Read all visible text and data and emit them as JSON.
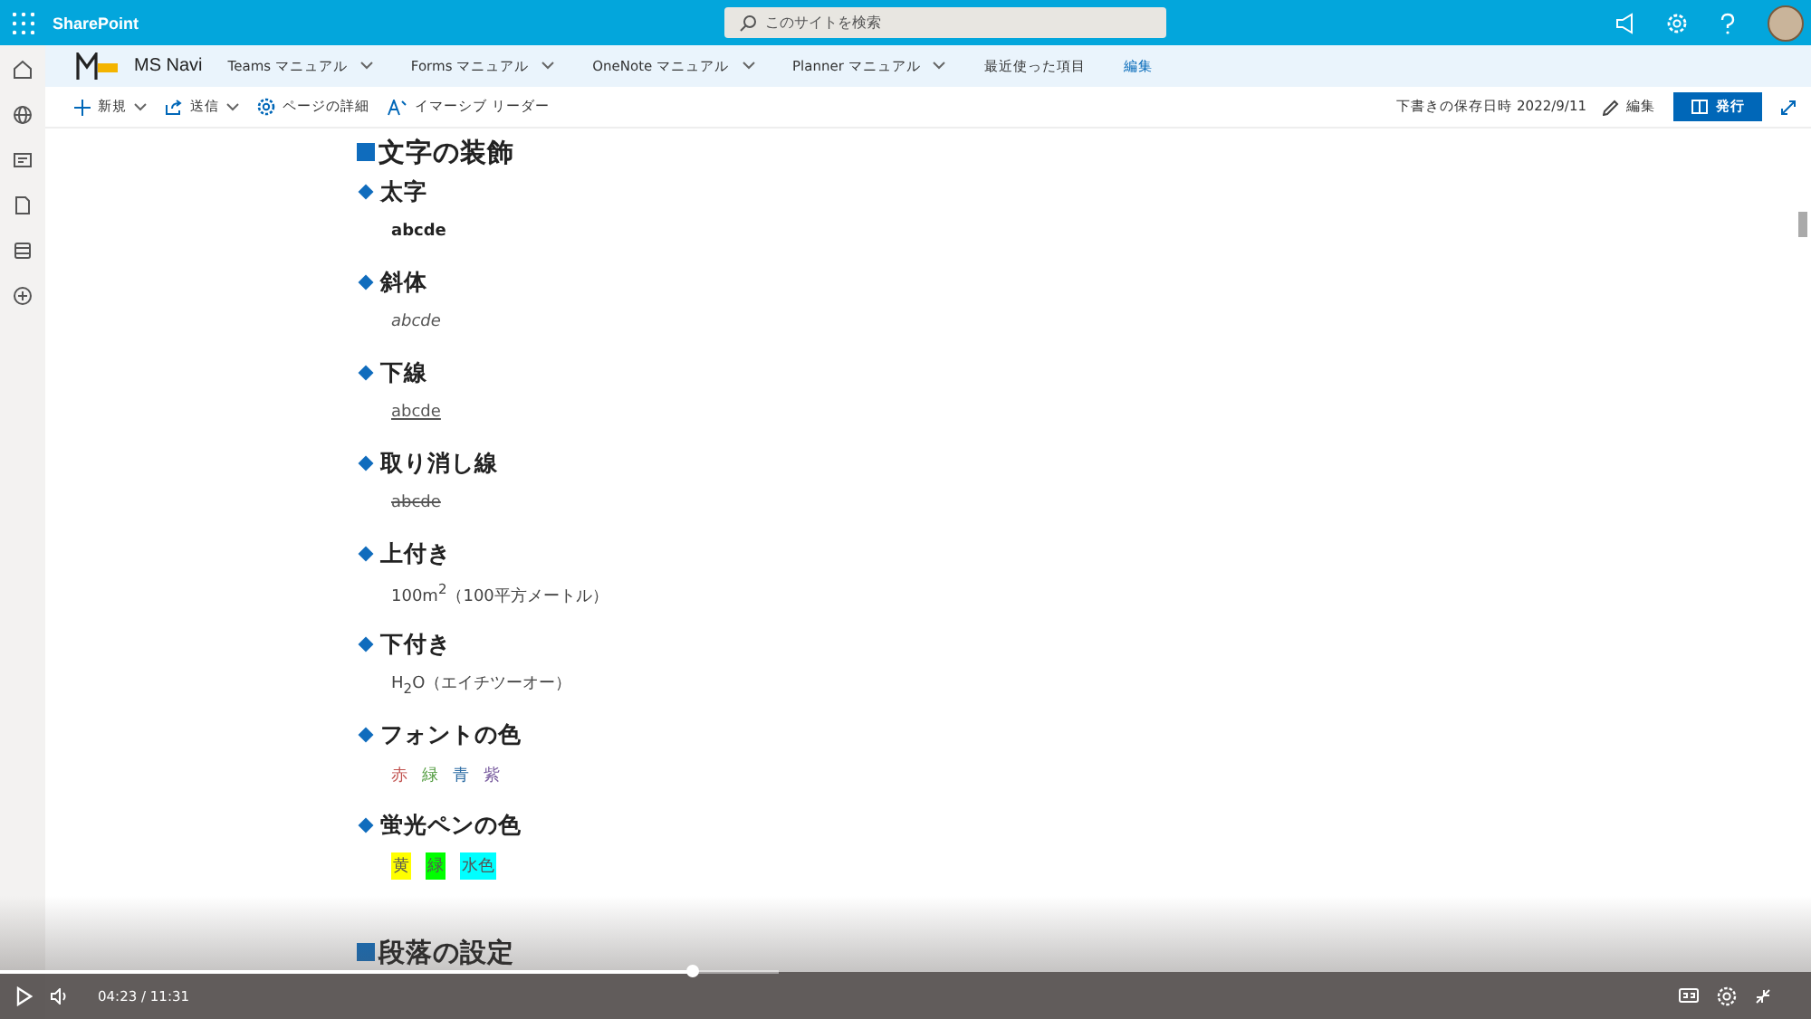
{
  "suite_bar": {
    "app_name": "SharePoint",
    "search": {
      "placeholder": "このサイトを検索"
    }
  },
  "site_nav": {
    "site_name": "MS Navi",
    "items": [
      {
        "label": "Teams マニュアル",
        "dropdown": true
      },
      {
        "label": "Forms マニュアル",
        "dropdown": true
      },
      {
        "label": "OneNote マニュアル",
        "dropdown": true
      },
      {
        "label": "Planner マニュアル",
        "dropdown": true
      },
      {
        "label": "最近使った項目",
        "dropdown": false
      }
    ],
    "edit_link": "編集"
  },
  "command_bar": {
    "items": [
      {
        "label": "新規",
        "dropdown": true
      },
      {
        "label": "送信",
        "dropdown": true
      },
      {
        "label": "ページの詳細",
        "dropdown": false
      },
      {
        "label": "イマーシブ リーダー",
        "dropdown": false
      }
    ],
    "saved_text": "下書きの保存日時 2022/9/11",
    "edit_button": "編集",
    "publish_button": "発行"
  },
  "content": {
    "title": "文字の装飾",
    "sections": [
      {
        "heading": "太字",
        "kind": "bold",
        "text": "abcde"
      },
      {
        "heading": "斜体",
        "kind": "italic",
        "text": "abcde"
      },
      {
        "heading": "下線",
        "kind": "underline",
        "text": "abcde"
      },
      {
        "heading": "取り消し線",
        "kind": "strike",
        "text": "abcde"
      },
      {
        "heading": "上付き",
        "kind": "rich",
        "text": "100m$^{2}$（100平方メートル）"
      },
      {
        "heading": "下付き",
        "kind": "rich",
        "text": "H$_{2}$O（エイチツーオー）"
      },
      {
        "heading": "フォントの色",
        "kind": "font_colors",
        "items": [
          {
            "text": "赤",
            "color": "#c0504d"
          },
          {
            "text": "緑",
            "color": "#4f9a3c"
          },
          {
            "text": "青",
            "color": "#2e6da4"
          },
          {
            "text": "紫",
            "color": "#7b5fa0"
          }
        ]
      },
      {
        "heading": "蛍光ペンの色",
        "kind": "highlights",
        "items": [
          {
            "text": "黄",
            "color": "#ffff00"
          },
          {
            "text": "緑",
            "color": "#00ff00"
          },
          {
            "text": "水色",
            "color": "#00ffff"
          }
        ]
      }
    ],
    "next_title": "段落の設定"
  },
  "video_player": {
    "time": "04:23 / 11:31",
    "level": 0.888
  }
}
